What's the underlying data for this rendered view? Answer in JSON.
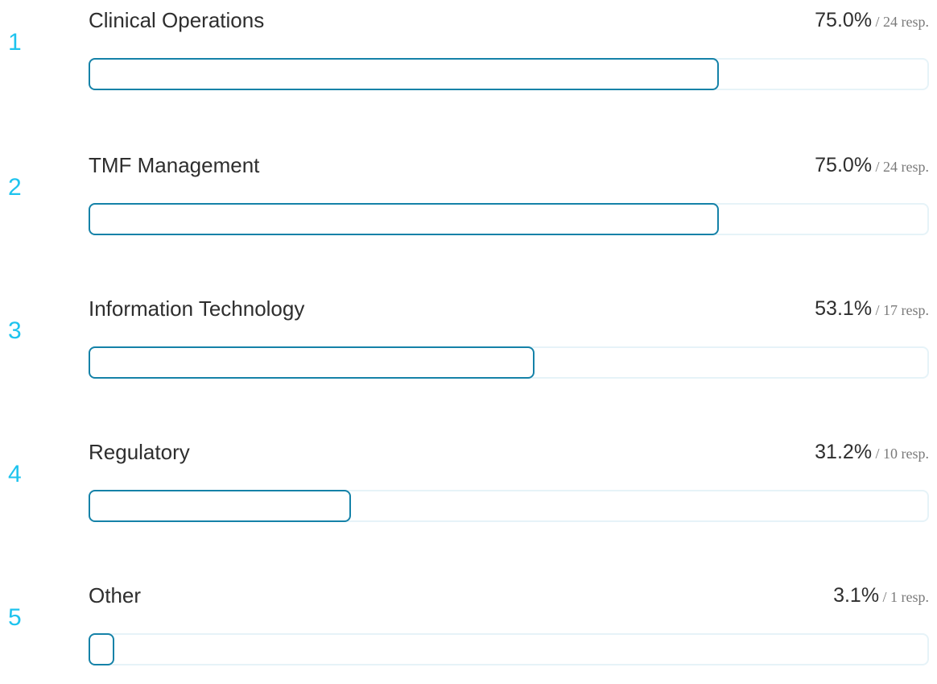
{
  "chart_data": {
    "type": "bar",
    "orientation": "horizontal",
    "categories": [
      "Clinical Operations",
      "TMF Management",
      "Information Technology",
      "Regulatory",
      "Other"
    ],
    "values": [
      75.0,
      75.0,
      53.1,
      31.2,
      3.1
    ],
    "responses": [
      24,
      24,
      17,
      10,
      1
    ],
    "xlim": [
      0,
      100
    ],
    "unit": "%",
    "grid": false,
    "legend": "none"
  },
  "rows": [
    {
      "rank": "1",
      "label": "Clinical Operations",
      "percent": "75.0%",
      "responses": "/ 24 resp."
    },
    {
      "rank": "2",
      "label": "TMF Management",
      "percent": "75.0%",
      "responses": "/ 24 resp."
    },
    {
      "rank": "3",
      "label": "Information Technology",
      "percent": "53.1%",
      "responses": "/ 17 resp."
    },
    {
      "rank": "4",
      "label": "Regulatory",
      "percent": "31.2%",
      "responses": "/ 10 resp."
    },
    {
      "rank": "5",
      "label": "Other",
      "percent": "3.1%",
      "responses": "/ 1 resp."
    }
  ],
  "colors": {
    "rank": "#1ec3ee",
    "bar_border": "#1582a8",
    "track_border": "#e6f3f8",
    "text": "#2e2e2e",
    "muted": "#7a7a7a"
  }
}
